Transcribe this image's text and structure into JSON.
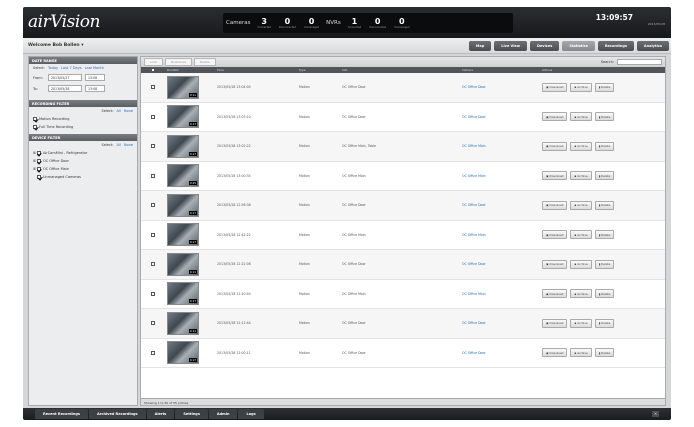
{
  "app": {
    "logo": "airVision"
  },
  "stats": {
    "cameras_label": "Cameras",
    "nvrs_label": "NVRs",
    "cameras": [
      {
        "num": "3",
        "label": "Connected"
      },
      {
        "num": "0",
        "label": "Disconnected"
      },
      {
        "num": "0",
        "label": "Unmanaged"
      }
    ],
    "nvrs": [
      {
        "num": "1",
        "label": "Connected"
      },
      {
        "num": "0",
        "label": "Disconnected"
      },
      {
        "num": "0",
        "label": "Unmanaged"
      }
    ]
  },
  "clock": {
    "time": "13:09:57",
    "date": "2013/05/28"
  },
  "welcome": "Welcome Bob Bollen ▾",
  "nav_tabs": [
    {
      "label": "Map",
      "active": false
    },
    {
      "label": "Live View",
      "active": false
    },
    {
      "label": "Devices",
      "active": false
    },
    {
      "label": "Statistics",
      "active": true
    },
    {
      "label": "Recordings",
      "active": false
    },
    {
      "label": "Analytics",
      "active": false
    }
  ],
  "sidebar": {
    "date_range": {
      "title": "DATE RANGE",
      "select_label": "Select:",
      "links": [
        "Today",
        "Last 7 Days",
        "Last Month"
      ],
      "from_label": "From:",
      "from_date": "2013/05/27",
      "from_time": "13:08",
      "to_label": "To:",
      "to_date": "2013/05/28",
      "to_time": "13:08"
    },
    "recording_filter": {
      "title": "RECORDING FILTER",
      "select_label": "Select:",
      "all": "All",
      "none": "None",
      "options": [
        "Motion Recording",
        "Full Time Recording"
      ]
    },
    "device_filter": {
      "title": "DEVICE FILTER",
      "select_label": "Select:",
      "all": "All",
      "none": "None",
      "devices": [
        "AirCamMini - Refrigerator",
        "OC Office Door",
        "OC Office Main",
        "Unmanaged Cameras"
      ]
    }
  },
  "toolbar": {
    "buttons": [
      "Lock",
      "Download",
      "Delete"
    ],
    "search_label": "Search:"
  },
  "table": {
    "headers": [
      "",
      "Duration",
      "Time",
      "Type",
      "Info",
      "Camera",
      "Actions"
    ],
    "action_labels": [
      "Download",
      "Archive",
      "Delete"
    ],
    "rows": [
      {
        "duration": "0:11",
        "time": "2013/05/28 13:04:00",
        "type": "Motion",
        "info": "OC Office Door",
        "camera": "OC Office Door"
      },
      {
        "duration": "0:17",
        "time": "2013/05/28 13:03:10",
        "type": "Motion",
        "info": "OC Office Door",
        "camera": "OC Office Door"
      },
      {
        "duration": "0:17",
        "time": "2013/05/28 13:02:22",
        "type": "Motion",
        "info": "OC Office Main, Table",
        "camera": "OC Office Main"
      },
      {
        "duration": "0:25",
        "time": "2013/05/28 13:00:34",
        "type": "Motion",
        "info": "OC Office Main",
        "camera": "OC Office Main"
      },
      {
        "duration": "0:17",
        "time": "2013/05/28 12:56:38",
        "type": "Motion",
        "info": "OC Office Door",
        "camera": "OC Office Door"
      },
      {
        "duration": "0:17",
        "time": "2013/05/28 12:42:22",
        "type": "Motion",
        "info": "OC Office Main",
        "camera": "OC Office Main"
      },
      {
        "duration": "0:11",
        "time": "2013/05/28 12:22:08",
        "type": "Motion",
        "info": "OC Office Door",
        "camera": "OC Office Door"
      },
      {
        "duration": "0:17",
        "time": "2013/05/28 12:20:40",
        "type": "Motion",
        "info": "OC Office Main",
        "camera": "OC Office Main"
      },
      {
        "duration": "0:11",
        "time": "2013/05/28 12:12:44",
        "type": "Motion",
        "info": "OC Office Door",
        "camera": "OC Office Door"
      },
      {
        "duration": "0:17",
        "time": "2013/05/28 12:00:11",
        "type": "Motion",
        "info": "OC Office Door",
        "camera": "OC Office Door"
      }
    ],
    "footer": "Showing 1 to 50 of 55 entries"
  },
  "bottom_tabs": [
    {
      "label": "Recent Recordings",
      "active": false
    },
    {
      "label": "Archived Recordings",
      "active": false
    },
    {
      "label": "Alerts",
      "active": false
    },
    {
      "label": "Settings",
      "active": false
    },
    {
      "label": "Admin",
      "active": false
    },
    {
      "label": "Logs",
      "active": false
    }
  ],
  "close_label": "×"
}
